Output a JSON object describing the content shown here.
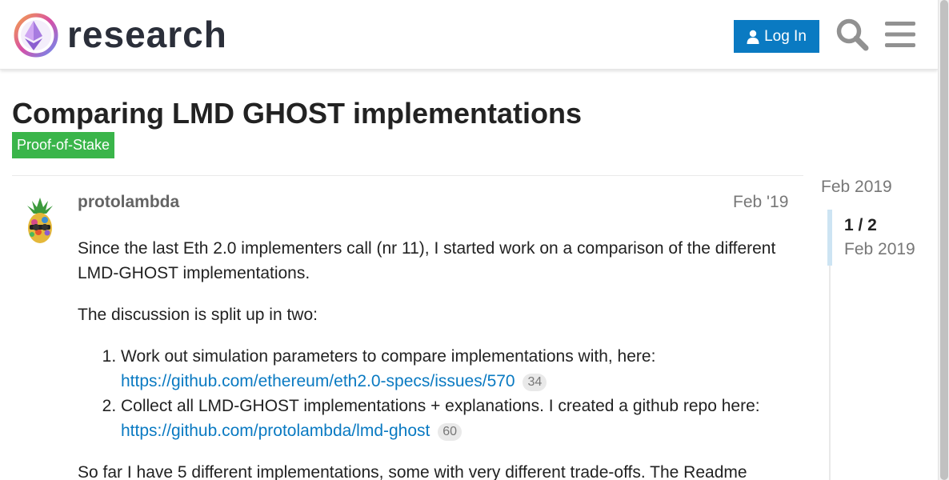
{
  "header": {
    "brand": "research",
    "login_label": "Log In"
  },
  "topic": {
    "title": "Comparing LMD GHOST implementations",
    "category": "Proof-of-Stake",
    "category_color": "#3ab54a"
  },
  "post": {
    "username": "protolambda",
    "date": "Feb '19",
    "intro": "Since the last Eth 2.0 implementers call (nr 11), I started work on a comparison of the different LMD-GHOST implementations.",
    "split_text": "The discussion is split up in two:",
    "items": [
      {
        "text": "Work out simulation parameters to compare implementations with, here:",
        "link": "https://github.com/ethereum/eth2.0-specs/issues/570",
        "clicks": "34"
      },
      {
        "text": "Collect all LMD-GHOST implementations + explanations. I created a github repo here:",
        "link": "https://github.com/protolambda/lmd-ghost",
        "clicks": "60"
      }
    ],
    "continuation": "So far I have 5 different implementations, some with very different trade-offs. The Readme"
  },
  "timeline": {
    "top_date": "Feb 2019",
    "position": "1 / 2",
    "current_date": "Feb 2019"
  },
  "colors": {
    "accent": "#0a7ac2",
    "brand_text": "#2b2f3a"
  },
  "icons": [
    "ethereum-logo-icon",
    "user-icon",
    "search-icon",
    "hamburger-menu-icon"
  ]
}
